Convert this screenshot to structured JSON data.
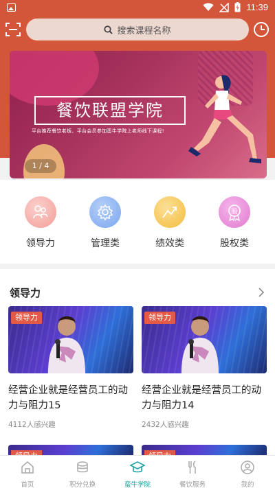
{
  "status_bar": {
    "time": "11:39"
  },
  "header": {
    "search_placeholder": "搜索课程名称"
  },
  "banner": {
    "title": "餐饮联盟学院",
    "subtitle": "平台推荐餐饮老板、平台会员参加蛮牛学院上老师线下课程!",
    "indicator": "1 / 4"
  },
  "categories": [
    {
      "label": "领导力",
      "color": "#f7a3a0",
      "icon": "leader-icon"
    },
    {
      "label": "管理类",
      "color": "#7aa8f0",
      "icon": "gear-icon"
    },
    {
      "label": "绩效类",
      "color": "#f5c04a",
      "icon": "trend-icon"
    },
    {
      "label": "股权类",
      "color": "#e57fd3",
      "icon": "badge-icon"
    }
  ],
  "section": {
    "title": "领导力",
    "cards": [
      {
        "tag": "领导力",
        "title": "经营企业就是经营员工的动力与阻力15",
        "meta": "4112人感兴趣"
      },
      {
        "tag": "领导力",
        "title": "经营企业就是经营员工的动力与阻力14",
        "meta": "2432人感兴趣"
      }
    ],
    "peek_tags": [
      "领导力",
      "领导力"
    ]
  },
  "tabs": [
    {
      "label": "首页",
      "icon": "home-icon"
    },
    {
      "label": "积分兑换",
      "icon": "coins-icon"
    },
    {
      "label": "蛮牛学院",
      "icon": "academy-icon",
      "active": true
    },
    {
      "label": "餐饮服务",
      "icon": "utensils-icon"
    },
    {
      "label": "我的",
      "icon": "profile-icon"
    }
  ],
  "colors": {
    "header": "#d4563a",
    "accent": "#1aa3a0",
    "tag": "#e35b46"
  }
}
